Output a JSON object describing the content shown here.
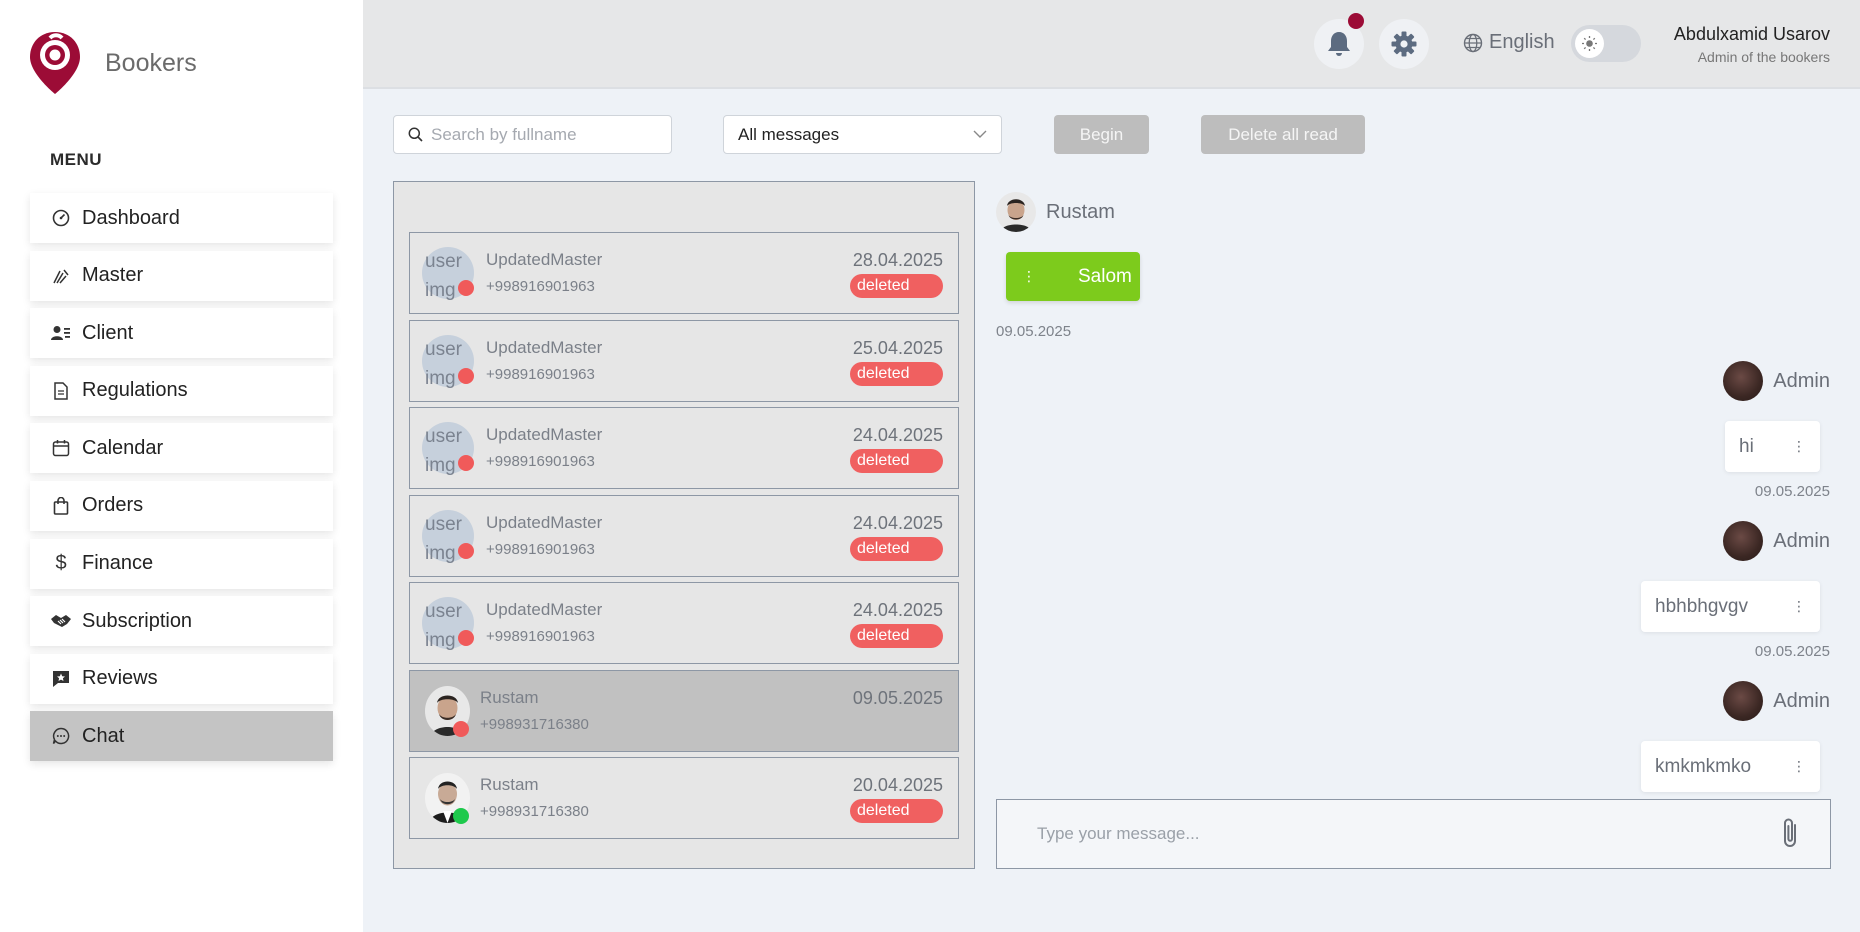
{
  "brand": {
    "name": "Bookers",
    "accent": "#9c0c36"
  },
  "sidebar": {
    "menu_title": "MENU",
    "items": [
      {
        "label": "Dashboard",
        "icon": "dashboard-icon"
      },
      {
        "label": "Master",
        "icon": "master-icon"
      },
      {
        "label": "Client",
        "icon": "client-icon"
      },
      {
        "label": "Regulations",
        "icon": "document-icon"
      },
      {
        "label": "Calendar",
        "icon": "calendar-icon"
      },
      {
        "label": "Orders",
        "icon": "shopping-bag-icon"
      },
      {
        "label": "Finance",
        "icon": "dollar-icon"
      },
      {
        "label": "Subscription",
        "icon": "handshake-icon"
      },
      {
        "label": "Reviews",
        "icon": "review-icon"
      },
      {
        "label": "Chat",
        "icon": "chat-icon",
        "active": true
      }
    ]
  },
  "header": {
    "language": "English",
    "user_name": "Abdulxamid Usarov",
    "user_role": "Admin of the bookers"
  },
  "toolbar": {
    "search_placeholder": "Search by fullname",
    "filter_value": "All messages",
    "begin_label": "Begin",
    "delete_label": "Delete all read"
  },
  "chats": [
    {
      "avatar_text": "user img",
      "name": "UpdatedMaster",
      "phone": "+998916901963",
      "date": "28.04.2025",
      "badge": "deleted",
      "status": "offline"
    },
    {
      "avatar_text": "user img",
      "name": "UpdatedMaster",
      "phone": "+998916901963",
      "date": "25.04.2025",
      "badge": "deleted",
      "status": "offline"
    },
    {
      "avatar_text": "user img",
      "name": "UpdatedMaster",
      "phone": "+998916901963",
      "date": "24.04.2025",
      "badge": "deleted",
      "status": "offline"
    },
    {
      "avatar_text": "user img",
      "name": "UpdatedMaster",
      "phone": "+998916901963",
      "date": "24.04.2025",
      "badge": "deleted",
      "status": "offline"
    },
    {
      "avatar_text": "user img",
      "name": "UpdatedMaster",
      "phone": "+998916901963",
      "date": "24.04.2025",
      "badge": "deleted",
      "status": "offline"
    },
    {
      "name": "Rustam",
      "phone": "+998931716380",
      "date": "09.05.2025",
      "status": "offline",
      "active": true
    },
    {
      "name": "Rustam",
      "phone": "+998931716380",
      "date": "20.04.2025",
      "badge": "deleted",
      "status": "online"
    }
  ],
  "conversation": {
    "contact_name": "Rustam",
    "incoming": {
      "text": "Salom",
      "date": "09.05.2025"
    },
    "outgoing": [
      {
        "sender": "Admin",
        "text": "hi",
        "date": "09.05.2025"
      },
      {
        "sender": "Admin",
        "text": "hbhbhgvgv",
        "date": "09.05.2025"
      },
      {
        "sender": "Admin",
        "text": "kmkmkmko"
      }
    ],
    "compose_placeholder": "Type your message..."
  },
  "colors": {
    "badge": "#f06060",
    "incoming_bubble": "#7dcb1c",
    "online": "#1ec94c"
  }
}
